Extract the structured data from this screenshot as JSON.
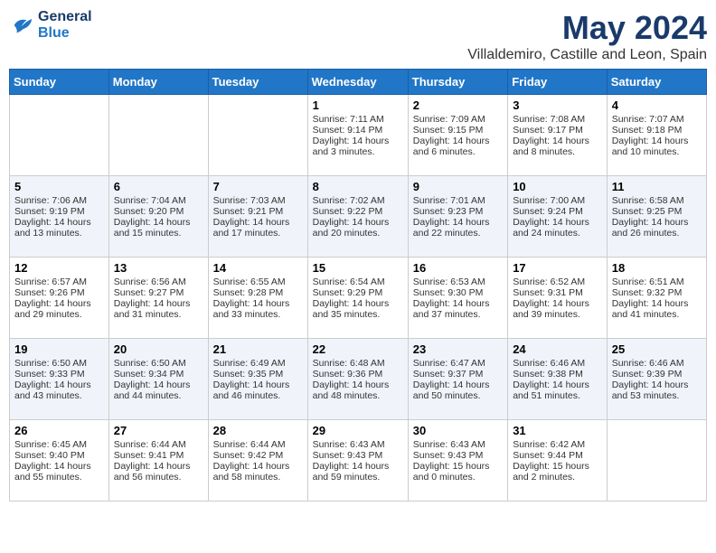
{
  "header": {
    "logo_line1": "General",
    "logo_line2": "Blue",
    "month": "May 2024",
    "location": "Villaldemiro, Castille and Leon, Spain"
  },
  "weekdays": [
    "Sunday",
    "Monday",
    "Tuesday",
    "Wednesday",
    "Thursday",
    "Friday",
    "Saturday"
  ],
  "weeks": [
    [
      {
        "day": "",
        "sunrise": "",
        "sunset": "",
        "daylight": ""
      },
      {
        "day": "",
        "sunrise": "",
        "sunset": "",
        "daylight": ""
      },
      {
        "day": "",
        "sunrise": "",
        "sunset": "",
        "daylight": ""
      },
      {
        "day": "1",
        "sunrise": "Sunrise: 7:11 AM",
        "sunset": "Sunset: 9:14 PM",
        "daylight": "Daylight: 14 hours and 3 minutes."
      },
      {
        "day": "2",
        "sunrise": "Sunrise: 7:09 AM",
        "sunset": "Sunset: 9:15 PM",
        "daylight": "Daylight: 14 hours and 6 minutes."
      },
      {
        "day": "3",
        "sunrise": "Sunrise: 7:08 AM",
        "sunset": "Sunset: 9:17 PM",
        "daylight": "Daylight: 14 hours and 8 minutes."
      },
      {
        "day": "4",
        "sunrise": "Sunrise: 7:07 AM",
        "sunset": "Sunset: 9:18 PM",
        "daylight": "Daylight: 14 hours and 10 minutes."
      }
    ],
    [
      {
        "day": "5",
        "sunrise": "Sunrise: 7:06 AM",
        "sunset": "Sunset: 9:19 PM",
        "daylight": "Daylight: 14 hours and 13 minutes."
      },
      {
        "day": "6",
        "sunrise": "Sunrise: 7:04 AM",
        "sunset": "Sunset: 9:20 PM",
        "daylight": "Daylight: 14 hours and 15 minutes."
      },
      {
        "day": "7",
        "sunrise": "Sunrise: 7:03 AM",
        "sunset": "Sunset: 9:21 PM",
        "daylight": "Daylight: 14 hours and 17 minutes."
      },
      {
        "day": "8",
        "sunrise": "Sunrise: 7:02 AM",
        "sunset": "Sunset: 9:22 PM",
        "daylight": "Daylight: 14 hours and 20 minutes."
      },
      {
        "day": "9",
        "sunrise": "Sunrise: 7:01 AM",
        "sunset": "Sunset: 9:23 PM",
        "daylight": "Daylight: 14 hours and 22 minutes."
      },
      {
        "day": "10",
        "sunrise": "Sunrise: 7:00 AM",
        "sunset": "Sunset: 9:24 PM",
        "daylight": "Daylight: 14 hours and 24 minutes."
      },
      {
        "day": "11",
        "sunrise": "Sunrise: 6:58 AM",
        "sunset": "Sunset: 9:25 PM",
        "daylight": "Daylight: 14 hours and 26 minutes."
      }
    ],
    [
      {
        "day": "12",
        "sunrise": "Sunrise: 6:57 AM",
        "sunset": "Sunset: 9:26 PM",
        "daylight": "Daylight: 14 hours and 29 minutes."
      },
      {
        "day": "13",
        "sunrise": "Sunrise: 6:56 AM",
        "sunset": "Sunset: 9:27 PM",
        "daylight": "Daylight: 14 hours and 31 minutes."
      },
      {
        "day": "14",
        "sunrise": "Sunrise: 6:55 AM",
        "sunset": "Sunset: 9:28 PM",
        "daylight": "Daylight: 14 hours and 33 minutes."
      },
      {
        "day": "15",
        "sunrise": "Sunrise: 6:54 AM",
        "sunset": "Sunset: 9:29 PM",
        "daylight": "Daylight: 14 hours and 35 minutes."
      },
      {
        "day": "16",
        "sunrise": "Sunrise: 6:53 AM",
        "sunset": "Sunset: 9:30 PM",
        "daylight": "Daylight: 14 hours and 37 minutes."
      },
      {
        "day": "17",
        "sunrise": "Sunrise: 6:52 AM",
        "sunset": "Sunset: 9:31 PM",
        "daylight": "Daylight: 14 hours and 39 minutes."
      },
      {
        "day": "18",
        "sunrise": "Sunrise: 6:51 AM",
        "sunset": "Sunset: 9:32 PM",
        "daylight": "Daylight: 14 hours and 41 minutes."
      }
    ],
    [
      {
        "day": "19",
        "sunrise": "Sunrise: 6:50 AM",
        "sunset": "Sunset: 9:33 PM",
        "daylight": "Daylight: 14 hours and 43 minutes."
      },
      {
        "day": "20",
        "sunrise": "Sunrise: 6:50 AM",
        "sunset": "Sunset: 9:34 PM",
        "daylight": "Daylight: 14 hours and 44 minutes."
      },
      {
        "day": "21",
        "sunrise": "Sunrise: 6:49 AM",
        "sunset": "Sunset: 9:35 PM",
        "daylight": "Daylight: 14 hours and 46 minutes."
      },
      {
        "day": "22",
        "sunrise": "Sunrise: 6:48 AM",
        "sunset": "Sunset: 9:36 PM",
        "daylight": "Daylight: 14 hours and 48 minutes."
      },
      {
        "day": "23",
        "sunrise": "Sunrise: 6:47 AM",
        "sunset": "Sunset: 9:37 PM",
        "daylight": "Daylight: 14 hours and 50 minutes."
      },
      {
        "day": "24",
        "sunrise": "Sunrise: 6:46 AM",
        "sunset": "Sunset: 9:38 PM",
        "daylight": "Daylight: 14 hours and 51 minutes."
      },
      {
        "day": "25",
        "sunrise": "Sunrise: 6:46 AM",
        "sunset": "Sunset: 9:39 PM",
        "daylight": "Daylight: 14 hours and 53 minutes."
      }
    ],
    [
      {
        "day": "26",
        "sunrise": "Sunrise: 6:45 AM",
        "sunset": "Sunset: 9:40 PM",
        "daylight": "Daylight: 14 hours and 55 minutes."
      },
      {
        "day": "27",
        "sunrise": "Sunrise: 6:44 AM",
        "sunset": "Sunset: 9:41 PM",
        "daylight": "Daylight: 14 hours and 56 minutes."
      },
      {
        "day": "28",
        "sunrise": "Sunrise: 6:44 AM",
        "sunset": "Sunset: 9:42 PM",
        "daylight": "Daylight: 14 hours and 58 minutes."
      },
      {
        "day": "29",
        "sunrise": "Sunrise: 6:43 AM",
        "sunset": "Sunset: 9:43 PM",
        "daylight": "Daylight: 14 hours and 59 minutes."
      },
      {
        "day": "30",
        "sunrise": "Sunrise: 6:43 AM",
        "sunset": "Sunset: 9:43 PM",
        "daylight": "Daylight: 15 hours and 0 minutes."
      },
      {
        "day": "31",
        "sunrise": "Sunrise: 6:42 AM",
        "sunset": "Sunset: 9:44 PM",
        "daylight": "Daylight: 15 hours and 2 minutes."
      },
      {
        "day": "",
        "sunrise": "",
        "sunset": "",
        "daylight": ""
      }
    ]
  ]
}
